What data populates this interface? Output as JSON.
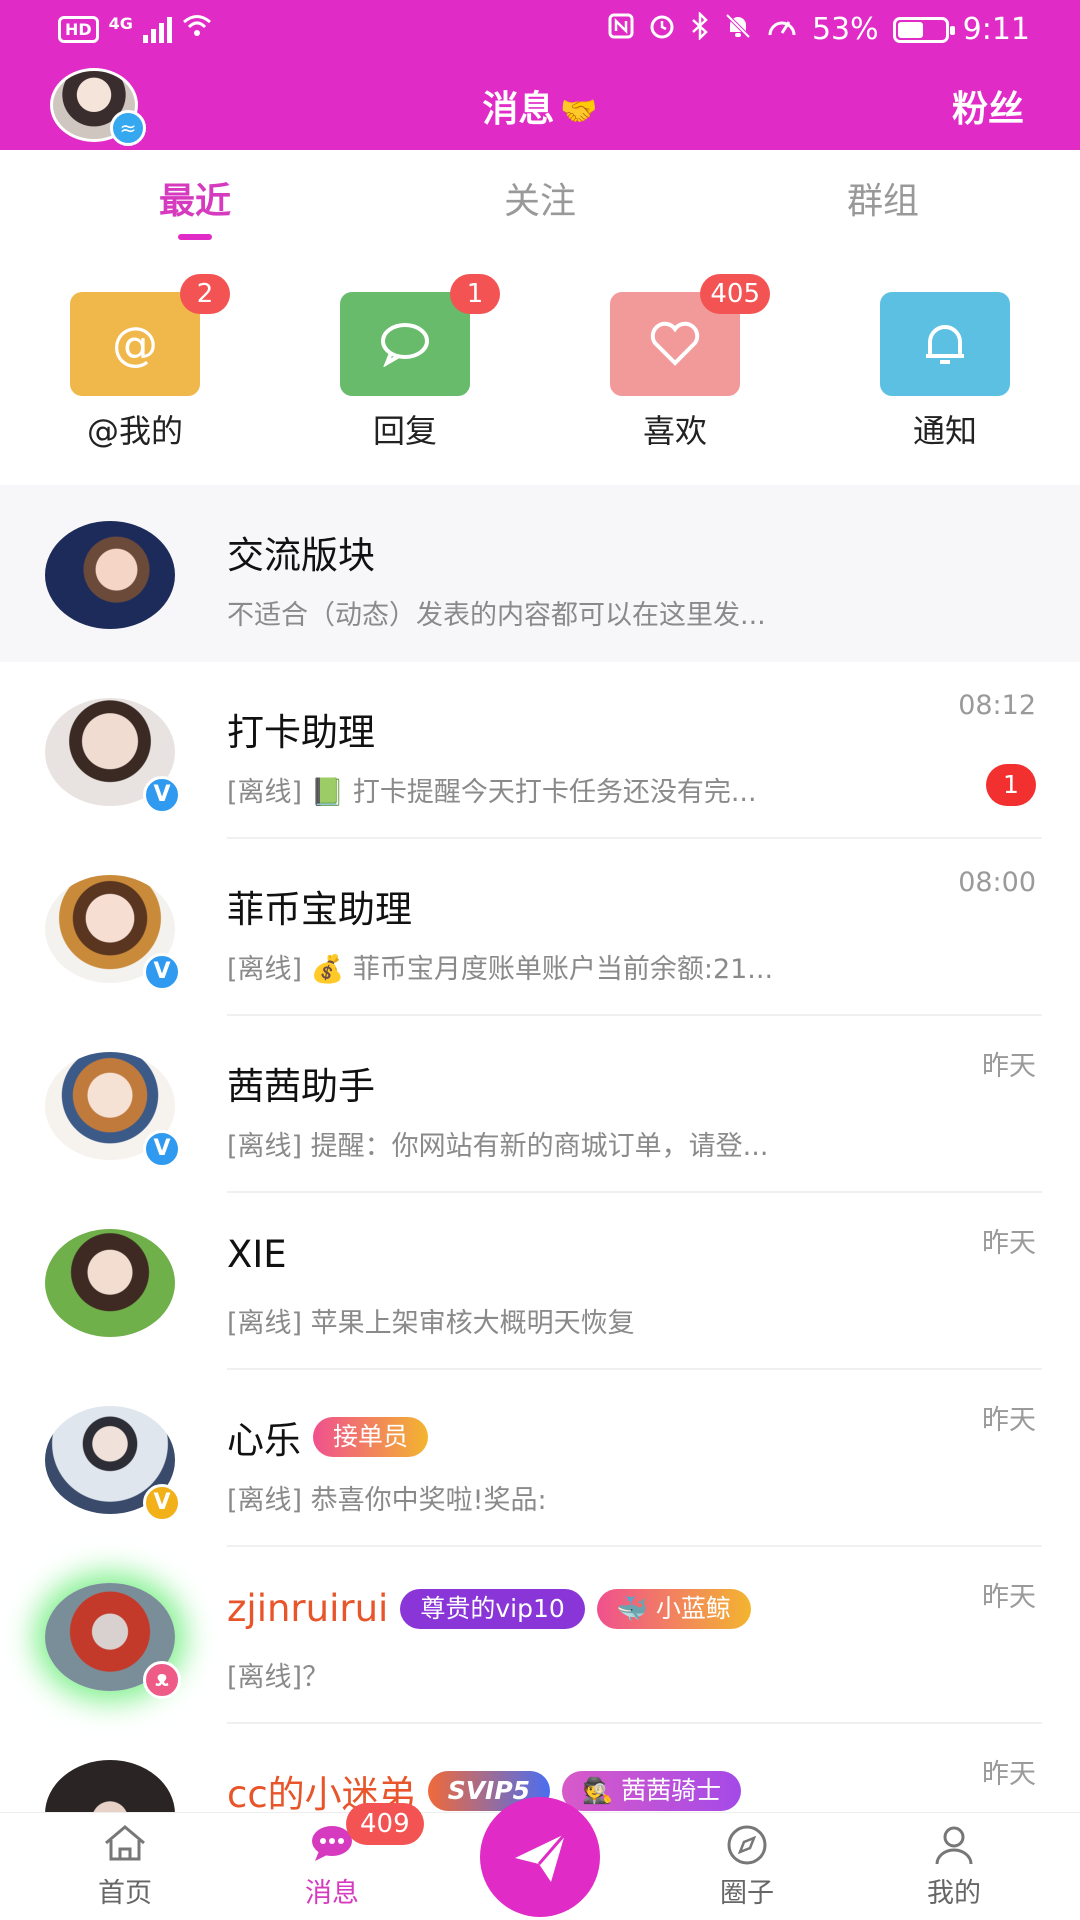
{
  "status_bar": {
    "hd": "HD",
    "network": "4G",
    "battery": "53%",
    "battery_level": 0.53,
    "time": "9:11"
  },
  "header": {
    "title": "消息",
    "title_icon": "handshake-icon",
    "right_link": "粉丝",
    "bg_color": "#e02bc6"
  },
  "tabs": [
    {
      "label": "最近",
      "active": true
    },
    {
      "label": "关注",
      "active": false
    },
    {
      "label": "群组",
      "active": false
    }
  ],
  "quick_actions": [
    {
      "label": "@我的",
      "icon": "at-icon",
      "badge": "2",
      "color": "#f0b84a"
    },
    {
      "label": "回复",
      "icon": "chat-bubble-icon",
      "badge": "1",
      "color": "#67bb6a"
    },
    {
      "label": "喜欢",
      "icon": "heart-icon",
      "badge": "405",
      "color": "#f29a9a"
    },
    {
      "label": "通知",
      "icon": "bell-icon",
      "badge": "",
      "color": "#5bc0e2"
    }
  ],
  "conversations": [
    {
      "name": "交流版块",
      "message": "不适合（动态）发表的内容都可以在这里发...",
      "time": "",
      "unread": "",
      "pinned": true
    },
    {
      "name": "打卡助理",
      "message": "[离线] 📗 打卡提醒今天打卡任务还没有完...",
      "time": "08:12",
      "unread": "1"
    },
    {
      "name": "菲币宝助理",
      "message": "[离线] 💰 菲币宝月度账单账户当前余额:21...",
      "time": "08:00",
      "unread": ""
    },
    {
      "name": "茜茜助手",
      "message": "[离线] 提醒：你网站有新的商城订单，请登...",
      "time": "昨天",
      "unread": ""
    },
    {
      "name": "XIE",
      "message": "[离线] 苹果上架审核大概明天恢复",
      "time": "昨天",
      "unread": ""
    },
    {
      "name": "心乐",
      "tag": "接单员",
      "message": "[离线] 恭喜你中奖啦!奖品:",
      "time": "昨天",
      "unread": ""
    },
    {
      "name": "zjinruirui",
      "tag": "尊贵的vip10",
      "tag2": "🐳 小蓝鲸",
      "message": "[离线]？",
      "time": "昨天",
      "unread": ""
    },
    {
      "name": "cc的小迷弟",
      "tag": "SVIP5",
      "tag2": "🕵 茜茜骑士",
      "message": "",
      "time": "昨天",
      "unread": ""
    }
  ],
  "bottom_nav": [
    {
      "label": "首页",
      "icon": "home-icon"
    },
    {
      "label": "消息",
      "icon": "message-icon",
      "badge": "409",
      "active": true
    },
    {
      "label": "",
      "icon": "paper-plane-icon"
    },
    {
      "label": "圈子",
      "icon": "compass-icon"
    },
    {
      "label": "我的",
      "icon": "user-icon"
    }
  ]
}
